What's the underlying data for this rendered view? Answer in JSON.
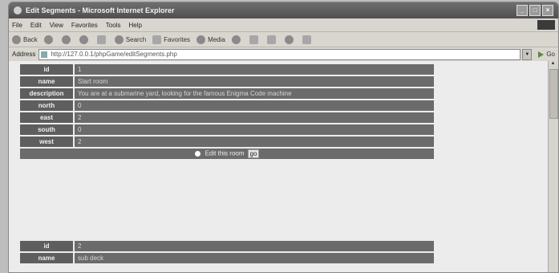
{
  "window": {
    "title": "Edit Segments - Microsoft Internet Explorer",
    "btn_min": "_",
    "btn_max": "□",
    "btn_close": "×"
  },
  "menu": [
    "File",
    "Edit",
    "View",
    "Favorites",
    "Tools",
    "Help"
  ],
  "toolbar": {
    "back": "Back",
    "forward": "",
    "search": "Search",
    "favorites": "Favorites",
    "media": "Media"
  },
  "address": {
    "label": "Address",
    "url": "http://127.0.0.1/phpGame/editSegments.php",
    "go": "Go"
  },
  "records": [
    {
      "fields": [
        {
          "name": "id",
          "value": "1"
        },
        {
          "name": "name",
          "value": "Start room"
        },
        {
          "name": "description",
          "value": "You are at a submarine yard, looking for the famous Enigma Code machine"
        },
        {
          "name": "north",
          "value": "0"
        },
        {
          "name": "east",
          "value": "2"
        },
        {
          "name": "south",
          "value": "0"
        },
        {
          "name": "west",
          "value": "2"
        }
      ],
      "edit_label": "Edit this room",
      "go_label": "go"
    },
    {
      "fields": [
        {
          "name": "id",
          "value": "2"
        },
        {
          "name": "name",
          "value": "sub deck"
        }
      ]
    }
  ]
}
